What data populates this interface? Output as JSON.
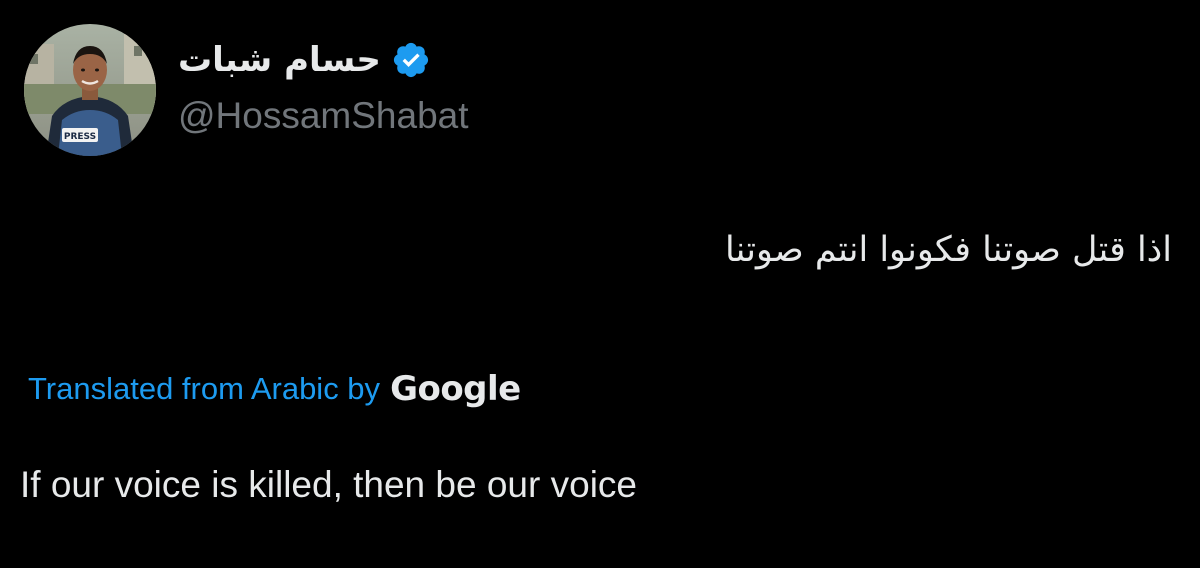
{
  "tweet": {
    "author": {
      "display_name": "حسام شبات",
      "handle": "@HossamShabat",
      "verified": true,
      "verified_icon": "verified-badge-icon",
      "avatar_badge_text": "PRESS"
    },
    "text_original": "اذا قتل صوتنا فكونوا انتم صوتنا",
    "translation": {
      "label": "Translated from Arabic by",
      "provider": "Google",
      "text": "If our voice is killed, then be our voice"
    }
  },
  "colors": {
    "background": "#000000",
    "text_primary": "#e7e9ea",
    "text_secondary": "#71767b",
    "accent": "#1d9bf0"
  }
}
